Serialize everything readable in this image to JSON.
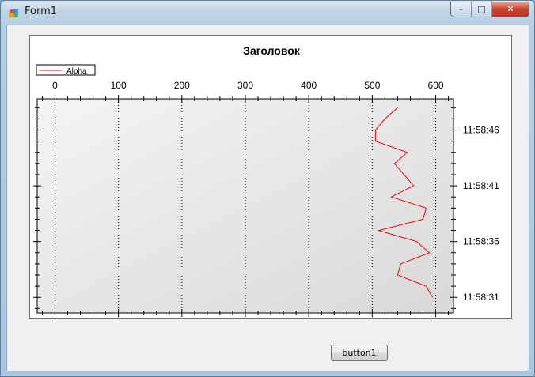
{
  "window": {
    "title": "Form1",
    "controls": {
      "minimize": "–",
      "maximize": "□",
      "close": "✕"
    },
    "icons": {
      "app": "form-app-icon"
    }
  },
  "chart_data": {
    "type": "line",
    "title": "Заголовок",
    "legend_position": "top-left",
    "grid": true,
    "x_axis": {
      "position": "top",
      "range": [
        -28,
        628
      ],
      "ticks": [
        0,
        100,
        200,
        300,
        400,
        500,
        600
      ]
    },
    "y_axis": {
      "position": "right",
      "unit": "time",
      "range": [
        "11:58:29.6",
        "11:58:48.8"
      ],
      "ticks": [
        "11:58:31",
        "11:58:36",
        "11:58:41",
        "11:58:46"
      ]
    },
    "series": [
      {
        "name": "Alpha",
        "color": "#ff0000",
        "points": [
          {
            "x": 595,
            "y": "11:58:31"
          },
          {
            "x": 585,
            "y": "11:58:32"
          },
          {
            "x": 540,
            "y": "11:58:33"
          },
          {
            "x": 545,
            "y": "11:58:34"
          },
          {
            "x": 590,
            "y": "11:58:35"
          },
          {
            "x": 570,
            "y": "11:58:36"
          },
          {
            "x": 510,
            "y": "11:58:37"
          },
          {
            "x": 580,
            "y": "11:58:38"
          },
          {
            "x": 585,
            "y": "11:58:39"
          },
          {
            "x": 530,
            "y": "11:58:40"
          },
          {
            "x": 565,
            "y": "11:58:41"
          },
          {
            "x": 550,
            "y": "11:58:42"
          },
          {
            "x": 535,
            "y": "11:58:43"
          },
          {
            "x": 555,
            "y": "11:58:44"
          },
          {
            "x": 505,
            "y": "11:58:45"
          },
          {
            "x": 505,
            "y": "11:58:46"
          },
          {
            "x": 520,
            "y": "11:58:47"
          },
          {
            "x": 540,
            "y": "11:58:48"
          }
        ]
      }
    ]
  },
  "button1": {
    "label": "button1"
  },
  "colors": {
    "series": "#ff0000",
    "plot_gradient_start": "#f4f4f4",
    "plot_gradient_end": "#d9d9d9"
  }
}
